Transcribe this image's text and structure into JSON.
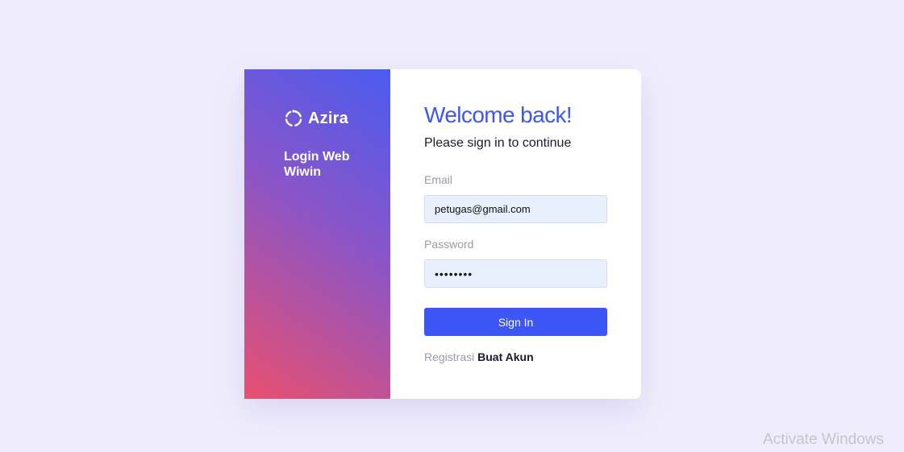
{
  "brand": {
    "name": "Azira",
    "tagline": "Login Web Wiwin",
    "logo_icon": "spinner-icon"
  },
  "form": {
    "title": "Welcome back!",
    "subtitle": "Please sign in to continue",
    "email_label": "Email",
    "email_value": "petugas@gmail.com",
    "password_label": "Password",
    "password_value": "12345678",
    "submit_label": "Sign In",
    "register_text": "Registrasi",
    "register_link": "Buat Akun"
  },
  "watermark": "Activate Windows",
  "colors": {
    "background": "#efedfd",
    "accent": "#3d57f6",
    "gradient_top": "#4a5cf0",
    "gradient_bottom": "#e9506f"
  }
}
